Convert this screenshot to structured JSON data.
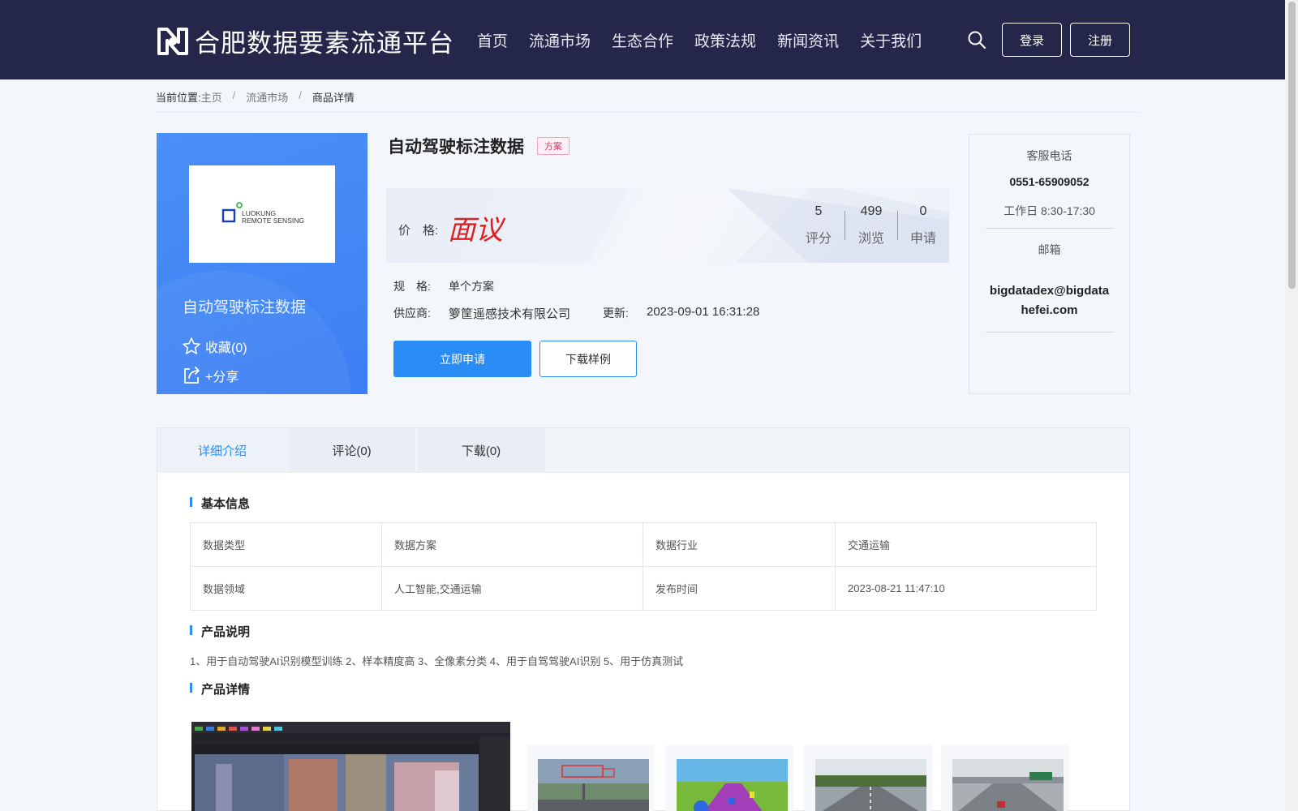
{
  "header": {
    "logo_text": "合肥数据要素流通平台",
    "nav": [
      "首页",
      "流通市场",
      "生态合作",
      "政策法规",
      "新闻资讯",
      "关于我们"
    ],
    "login_label": "登录",
    "register_label": "注册"
  },
  "breadcrumb": {
    "prefix": "当前位置:",
    "items": [
      "主页",
      "流通市场",
      "商品详情"
    ],
    "separator": "/"
  },
  "product": {
    "card_title": "自动驾驶标注数据",
    "logo_line1": "LUOKUNG",
    "logo_line2": "REMOTE SENSING",
    "favorite_label": "收藏(0)",
    "share_label": "+分享",
    "title": "自动驾驶标注数据",
    "tag": "方案",
    "price_label": "价　格:",
    "price_value": "面议",
    "stats": [
      {
        "num": "5",
        "label": "评分"
      },
      {
        "num": "499",
        "label": "浏览"
      },
      {
        "num": "0",
        "label": "申请"
      }
    ],
    "spec_label": "规　格:",
    "spec_value": "单个方案",
    "supplier_label": "供应商:",
    "supplier_value": "箩筐遥感技术有限公司",
    "update_label": "更新:",
    "update_value": "2023-09-01 16:31:28",
    "apply_button": "立即申请",
    "download_sample_button": "下载样例"
  },
  "contact": {
    "phone_label": "客服电话",
    "phone": "0551-65909052",
    "hours": "工作日 8:30-17:30",
    "email_label": "邮箱",
    "email_line1": "bigdatadex@bigdata",
    "email_line2": "hefei.com"
  },
  "tabs": [
    "详细介绍",
    "评论(0)",
    "下载(0)"
  ],
  "basic_info": {
    "title": "基本信息",
    "rows": [
      [
        "数据类型",
        "数据方案",
        "数据行业",
        "交通运输"
      ],
      [
        "数据领域",
        "人工智能,交通运输",
        "发布时间",
        "2023-08-21 11:47:10"
      ]
    ]
  },
  "product_desc": {
    "title": "产品说明",
    "text": "1、用于自动驾驶AI识别模型训练 2、样本精度高 3、全像素分类 4、用于自驾驾驶AI识别 5、用于仿真测试"
  },
  "product_detail": {
    "title": "产品详情"
  },
  "colors": {
    "header_bg": "#25274a",
    "accent": "#2a8cf5",
    "price": "#e02020",
    "tag": "#e0306e"
  }
}
